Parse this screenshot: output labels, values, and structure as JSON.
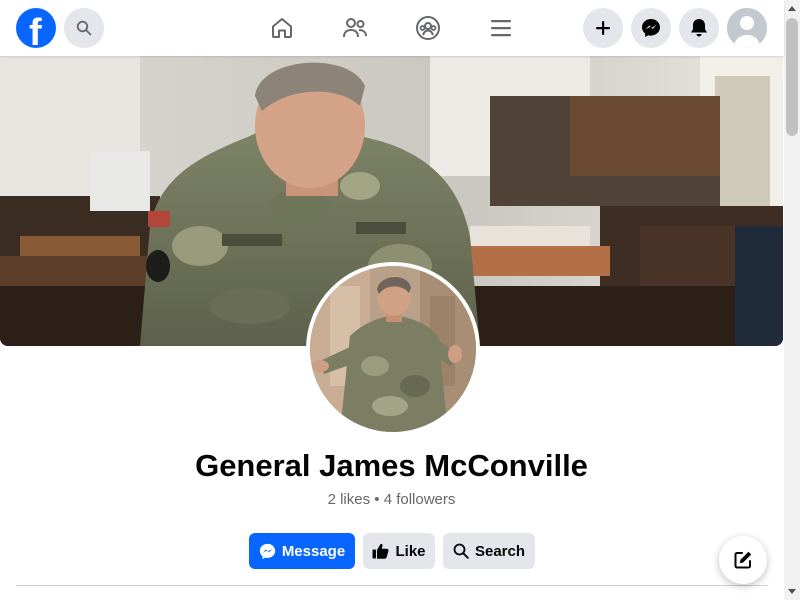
{
  "topbar": {
    "logo_letter": "f",
    "search_icon": "search-icon",
    "nav_icons": [
      "home-icon",
      "friends-icon",
      "groups-icon",
      "menu-icon"
    ],
    "right_icons": [
      "plus-icon",
      "messenger-icon",
      "bell-icon",
      "avatar"
    ]
  },
  "profile": {
    "name": "General James McConville",
    "stats": "2 likes • 4 followers"
  },
  "actions": {
    "message_label": "Message",
    "like_label": "Like",
    "search_label": "Search"
  },
  "colors": {
    "brand": "#0866ff",
    "secondary_button": "#e4e6eb",
    "text_primary": "#050505",
    "text_secondary": "#65676b"
  },
  "floating": {
    "compose_icon": "compose-icon"
  }
}
